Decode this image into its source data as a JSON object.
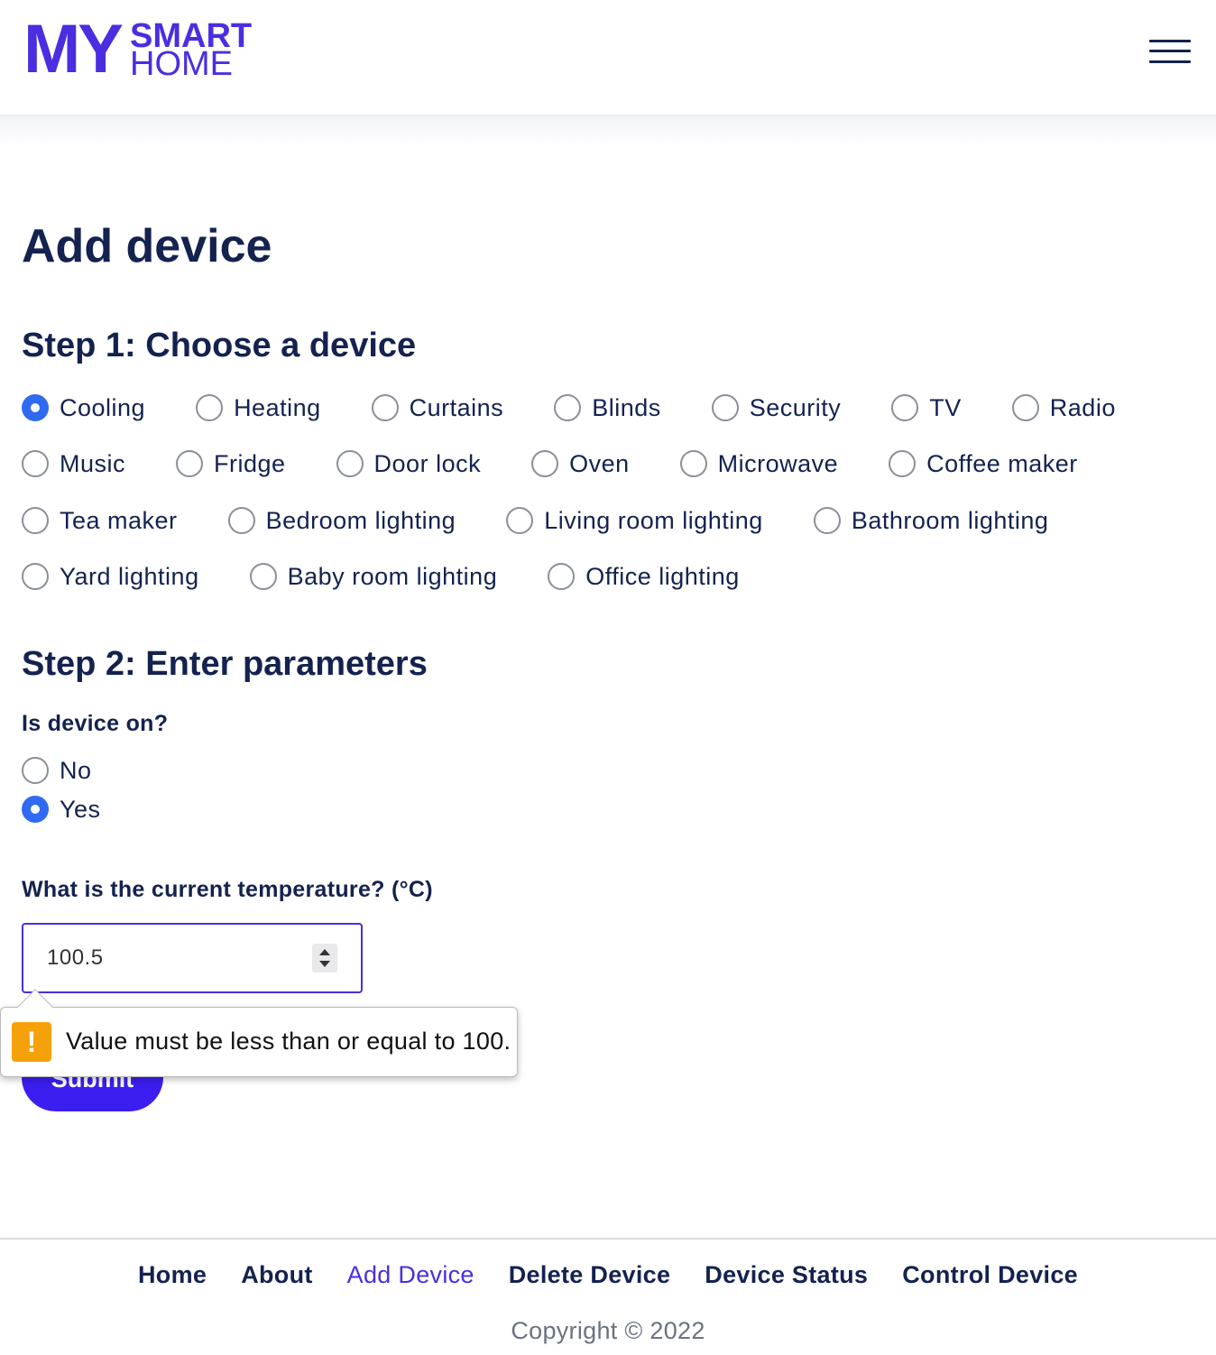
{
  "header": {
    "logo_my": "MY",
    "logo_smart": "SMART",
    "logo_home": "HOME",
    "menu_icon": "hamburger-menu-icon"
  },
  "page": {
    "title": "Add device"
  },
  "step1": {
    "title": "Step 1: Choose a device",
    "selected": "Cooling",
    "rows": [
      [
        {
          "label": "Cooling",
          "checked": true
        },
        {
          "label": "Heating",
          "checked": false
        },
        {
          "label": "Curtains",
          "checked": false
        },
        {
          "label": "Blinds",
          "checked": false
        },
        {
          "label": "Security",
          "checked": false
        },
        {
          "label": "TV",
          "checked": false
        },
        {
          "label": "Radio",
          "checked": false
        }
      ],
      [
        {
          "label": "Music",
          "checked": false
        },
        {
          "label": "Fridge",
          "checked": false
        },
        {
          "label": "Door lock",
          "checked": false
        },
        {
          "label": "Oven",
          "checked": false
        },
        {
          "label": "Microwave",
          "checked": false
        },
        {
          "label": "Coffee maker",
          "checked": false
        }
      ],
      [
        {
          "label": "Tea maker",
          "checked": false
        },
        {
          "label": "Bedroom lighting",
          "checked": false
        },
        {
          "label": "Living room lighting",
          "checked": false
        },
        {
          "label": "Bathroom lighting",
          "checked": false
        }
      ],
      [
        {
          "label": "Yard lighting",
          "checked": false
        },
        {
          "label": "Baby room lighting",
          "checked": false
        },
        {
          "label": "Office lighting",
          "checked": false
        }
      ]
    ]
  },
  "step2": {
    "title": "Step 2: Enter parameters",
    "power_question": "Is device on?",
    "power_options": [
      {
        "label": "No",
        "checked": false
      },
      {
        "label": "Yes",
        "checked": true
      }
    ],
    "temp_question": "What is the current temperature? (°C)",
    "temp_value": "100.5"
  },
  "validation": {
    "message": "Value must be less than or equal to 100.",
    "icon": "warning-icon",
    "icon_glyph": "!"
  },
  "form": {
    "submit_label": "Submit"
  },
  "footer": {
    "links": [
      {
        "label": "Home",
        "active": false
      },
      {
        "label": "About",
        "active": false
      },
      {
        "label": "Add Device",
        "active": true
      },
      {
        "label": "Delete Device",
        "active": false
      },
      {
        "label": "Device Status",
        "active": false
      },
      {
        "label": "Control Device",
        "active": false
      }
    ],
    "copyright": "Copyright © 2022"
  },
  "colors": {
    "brand": "#4a2ee0",
    "text": "#14224f",
    "radio_checked": "#2f6bf2",
    "warning": "#f5a20a",
    "submit": "#3b1ef0"
  }
}
